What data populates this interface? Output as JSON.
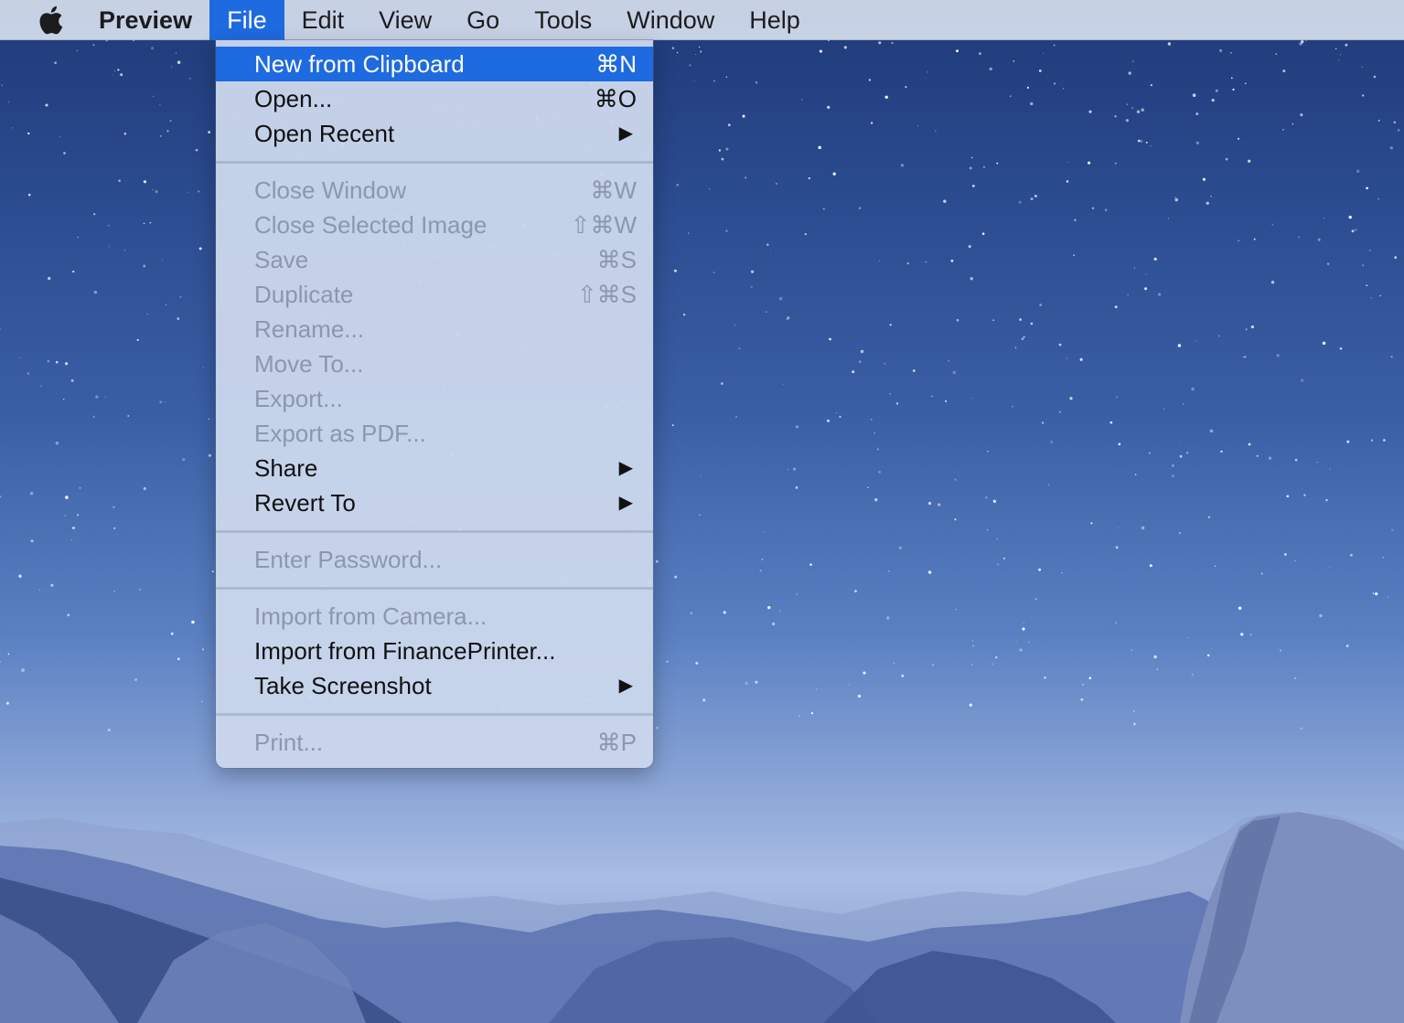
{
  "menubar": {
    "apple_icon": "apple-logo-icon",
    "items": [
      "Preview",
      "File",
      "Edit",
      "View",
      "Go",
      "Tools",
      "Window",
      "Help"
    ]
  },
  "file_menu": {
    "items": [
      {
        "label": "New from Clipboard",
        "shortcut": "⌘N",
        "state": "highlighted"
      },
      {
        "label": "Open...",
        "shortcut": "⌘O",
        "state": "enabled"
      },
      {
        "label": "Open Recent",
        "submenu": "▶",
        "state": "enabled"
      },
      {
        "label": "Close Window",
        "shortcut": "⌘W",
        "state": "disabled"
      },
      {
        "label": "Close Selected Image",
        "shortcut": "⇧⌘W",
        "state": "disabled"
      },
      {
        "label": "Save",
        "shortcut": "⌘S",
        "state": "disabled"
      },
      {
        "label": "Duplicate",
        "shortcut": "⇧⌘S",
        "state": "disabled"
      },
      {
        "label": "Rename...",
        "state": "disabled"
      },
      {
        "label": "Move To...",
        "state": "disabled"
      },
      {
        "label": "Export...",
        "state": "disabled"
      },
      {
        "label": "Export as PDF...",
        "state": "disabled"
      },
      {
        "label": "Share",
        "submenu": "▶",
        "state": "enabled"
      },
      {
        "label": "Revert To",
        "submenu": "▶",
        "state": "enabled"
      },
      {
        "label": "Enter Password...",
        "state": "disabled"
      },
      {
        "label": "Import from Camera...",
        "state": "disabled"
      },
      {
        "label": "Import from FinancePrinter...",
        "state": "enabled"
      },
      {
        "label": "Take Screenshot",
        "submenu": "▶",
        "state": "enabled"
      },
      {
        "label": "Print...",
        "shortcut": "⌘P",
        "state": "disabled"
      }
    ]
  },
  "colors": {
    "highlight": "#1e6ae0",
    "disabled_text": "#8d97ab",
    "menu_background": "#cad6ec"
  }
}
